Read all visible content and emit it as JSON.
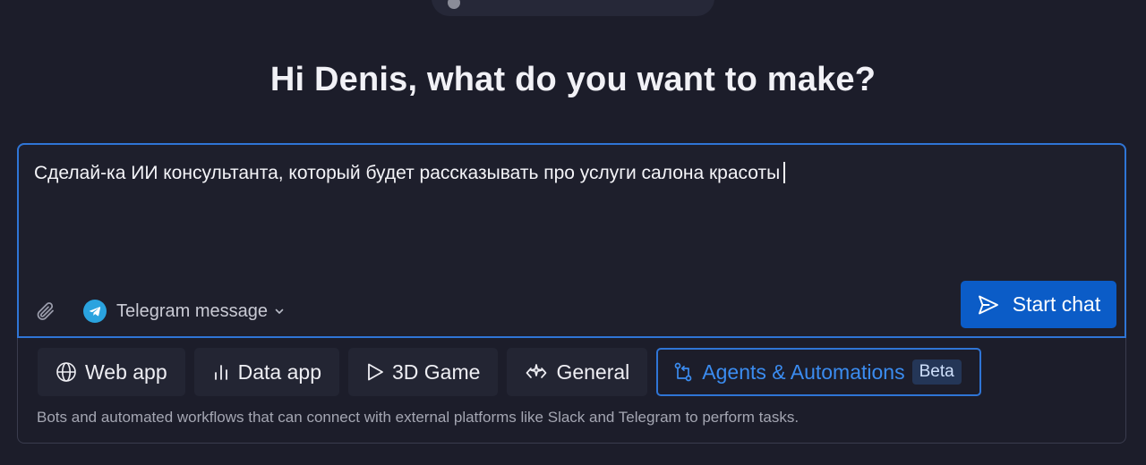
{
  "greeting": "Hi Denis, what do you want to make?",
  "prompt": {
    "value": "Сделай-ка ИИ консультанта, который будет рассказывать про услуги салона красоты"
  },
  "toolbar": {
    "attach_icon": "paperclip-icon",
    "channel_icon": "telegram-icon",
    "channel_label": "Telegram message",
    "channel_chevron_icon": "chevron-down-icon",
    "start_chat_label": "Start chat",
    "start_chat_icon": "send-icon"
  },
  "app_types": [
    {
      "label": "Web app",
      "icon": "globe-icon",
      "active": false
    },
    {
      "label": "Data app",
      "icon": "bar-chart-icon",
      "active": false
    },
    {
      "label": "3D Game",
      "icon": "play-icon",
      "active": false
    },
    {
      "label": "General",
      "icon": "sparkle-code-icon",
      "active": false
    },
    {
      "label": "Agents & Automations",
      "icon": "workflow-icon",
      "active": true,
      "badge": "Beta"
    }
  ],
  "description": "Bots and automated workflows that can connect with external platforms like Slack and Telegram to perform tasks.",
  "colors": {
    "background": "#1c1d2a",
    "accent": "#2f75d6",
    "primary_button": "#0b5cc7",
    "telegram": "#2aa3df"
  }
}
